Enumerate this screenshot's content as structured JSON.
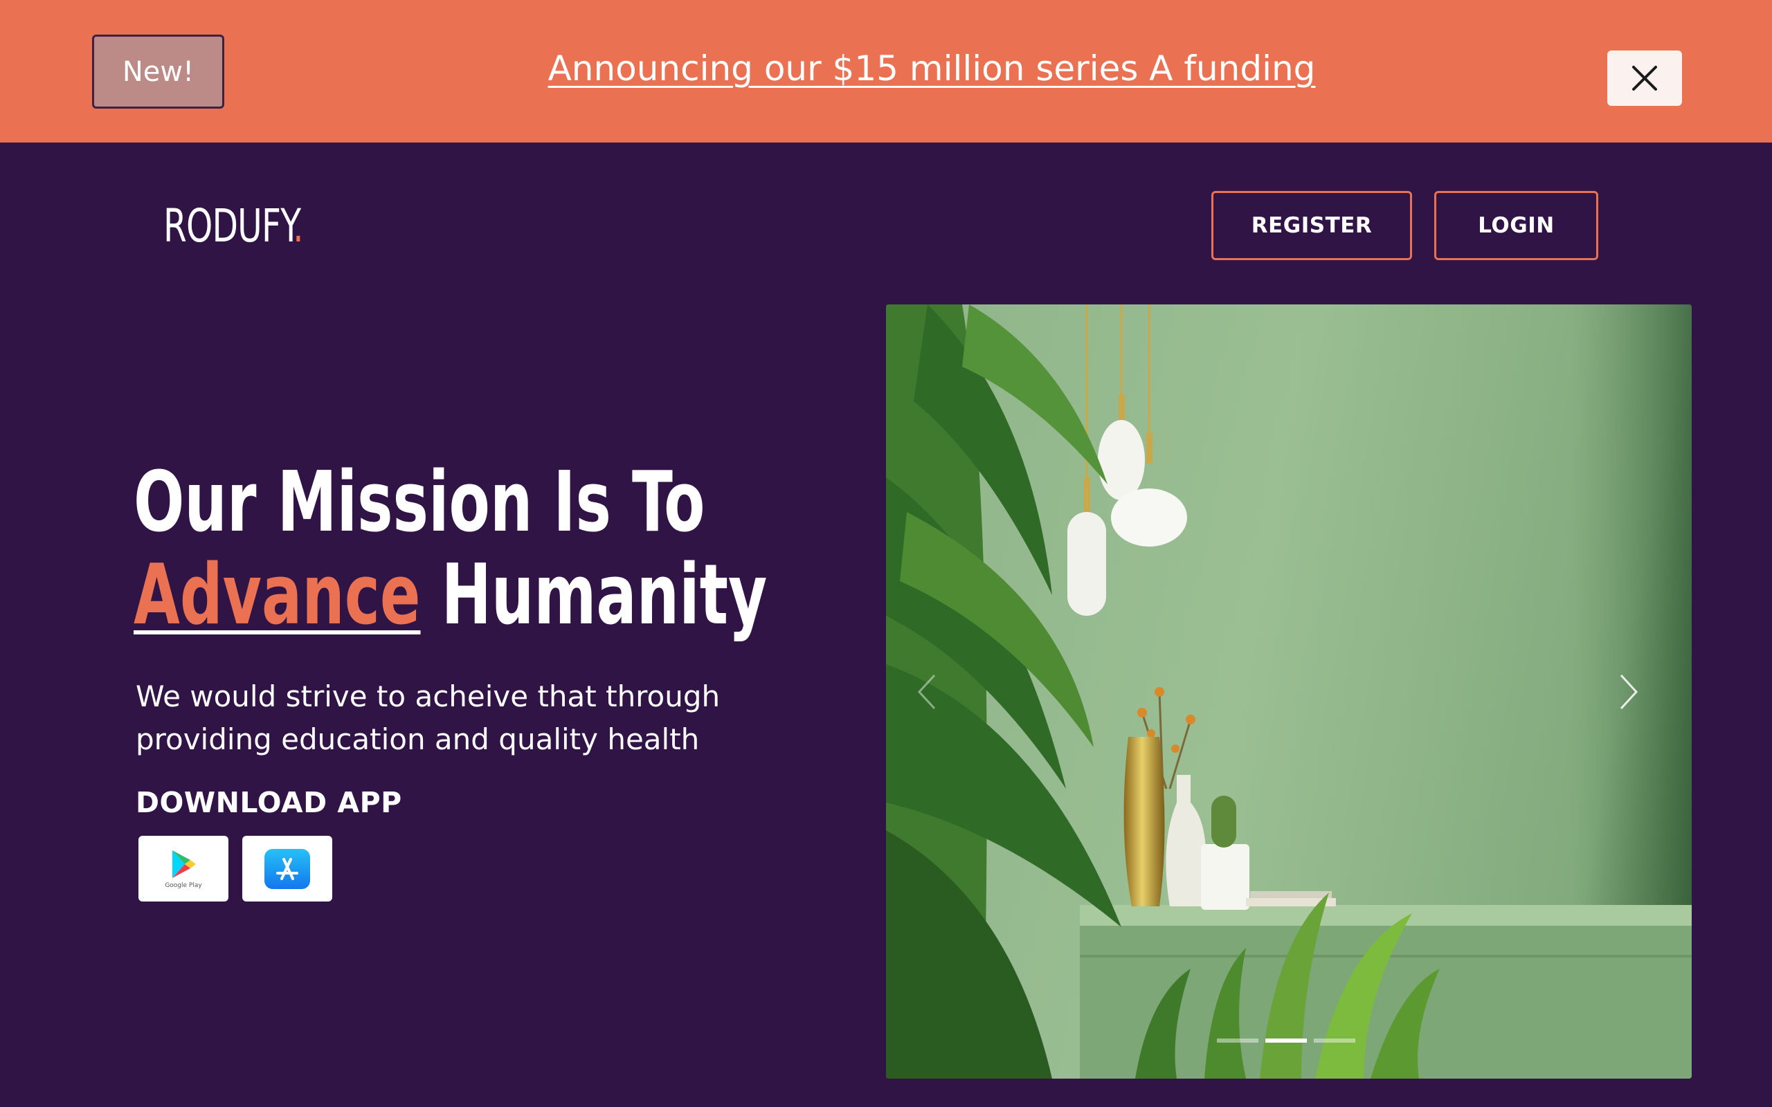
{
  "banner": {
    "badge_label": "New!",
    "announcement": "Announcing our $15 million series A funding",
    "close_icon": "close-icon"
  },
  "header": {
    "logo_text": "RODUFY",
    "logo_dot": ".",
    "register_label": "REGISTER",
    "login_label": "LOGIN"
  },
  "hero": {
    "title_line1": "Our Mission Is To",
    "title_accent": "Advance",
    "title_line2_rest": " Humanity",
    "subtitle": "We would strive to acheive that through providing education and quality health",
    "download_label": "DOWNLOAD APP",
    "stores": [
      {
        "icon": "google-play-icon",
        "caption": "Google Play"
      },
      {
        "icon": "app-store-icon"
      }
    ]
  },
  "carousel": {
    "prev_icon": "chevron-left-icon",
    "next_icon": "chevron-right-icon",
    "slide_count": 3,
    "active_slide": 2
  },
  "colors": {
    "accent": "#ea7152",
    "background": "#2f1445",
    "badge": "#bc8b88"
  }
}
